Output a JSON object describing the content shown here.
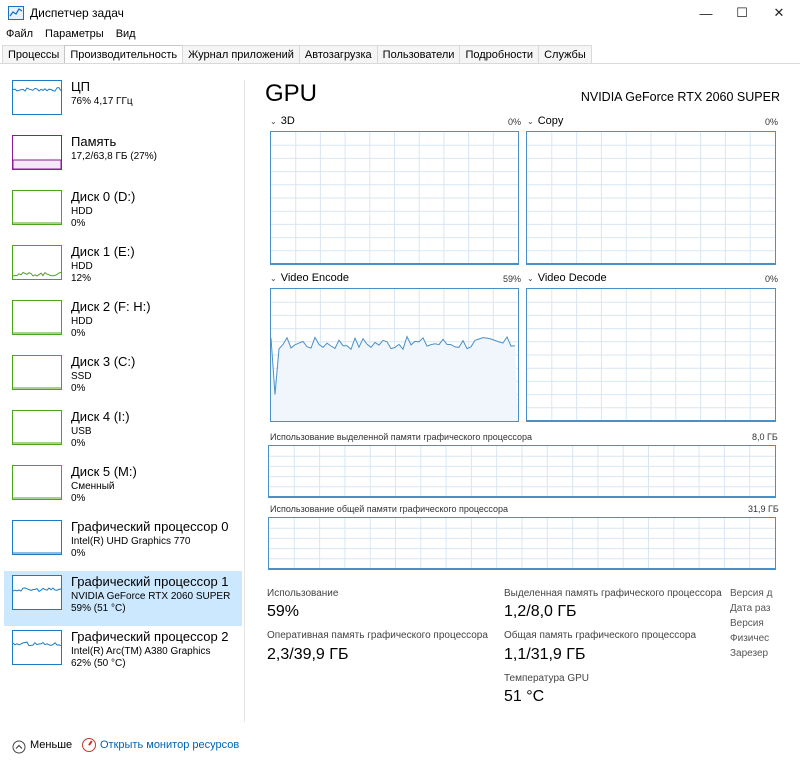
{
  "window": {
    "title": "Диспетчер задач",
    "minimize": "—",
    "maximize": "☐",
    "close": "✕"
  },
  "menu": [
    "Файл",
    "Параметры",
    "Вид"
  ],
  "tabs": [
    "Процессы",
    "Производительность",
    "Журнал приложений",
    "Автозагрузка",
    "Пользователи",
    "Подробности",
    "Службы"
  ],
  "active_tab": "Производительность",
  "sidebar": {
    "items": [
      {
        "name": "ЦП",
        "sub1": "76% 4,17 ГГц",
        "sub2": "",
        "color": "#1c7bc4",
        "usage": 0.76
      },
      {
        "name": "Память",
        "sub1": "17,2/63,8 ГБ (27%)",
        "sub2": "",
        "color": "#8a1b99",
        "usage": 0.27
      },
      {
        "name": "Диск 0 (D:)",
        "sub1": "HDD",
        "sub2": "0%",
        "color": "#4ca61c",
        "usage": 0
      },
      {
        "name": "Диск 1 (E:)",
        "sub1": "HDD",
        "sub2": "12%",
        "color": "#4ca61c",
        "usage": 0.12
      },
      {
        "name": "Диск 2 (F: H:)",
        "sub1": "HDD",
        "sub2": "0%",
        "color": "#4ca61c",
        "usage": 0
      },
      {
        "name": "Диск 3 (C:)",
        "sub1": "SSD",
        "sub2": "0%",
        "color": "#4ca61c",
        "usage": 0
      },
      {
        "name": "Диск 4 (I:)",
        "sub1": "USB",
        "sub2": "0%",
        "color": "#4ca61c",
        "usage": 0
      },
      {
        "name": "Диск 5 (M:)",
        "sub1": "Сменный",
        "sub2": "0%",
        "color": "#4ca61c",
        "usage": 0
      },
      {
        "name": "Графический процессор 0",
        "sub1": "Intel(R) UHD Graphics 770",
        "sub2": "0%",
        "color": "#1c7bc4",
        "usage": 0
      },
      {
        "name": "Графический процессор 1",
        "sub1": "NVIDIA GeForce RTX 2060 SUPER",
        "sub2": "59% (51 °C)",
        "color": "#1c7bc4",
        "usage": 0.59
      },
      {
        "name": "Графический процессор 2",
        "sub1": "Intel(R) Arc(TM) A380 Graphics",
        "sub2": "62% (50 °C)",
        "color": "#1c7bc4",
        "usage": 0.62
      }
    ],
    "selected_index": 9
  },
  "main": {
    "title": "GPU",
    "gpu_name": "NVIDIA GeForce RTX 2060 SUPER",
    "engines": [
      {
        "label": "3D",
        "pct": "0%",
        "usage": 0
      },
      {
        "label": "Copy",
        "pct": "0%",
        "usage": 0
      },
      {
        "label": "Video Encode",
        "pct": "59%",
        "usage": 0.59
      },
      {
        "label": "Video Decode",
        "pct": "0%",
        "usage": 0
      }
    ],
    "dedicated_mem": {
      "label": "Использование выделенной памяти графического процессора",
      "max": "8,0 ГБ"
    },
    "shared_mem": {
      "label": "Использование общей памяти графического процессора",
      "max": "31,9 ГБ"
    },
    "stats": {
      "usage_label": "Использование",
      "usage_value": "59%",
      "dedicated_label": "Выделенная память графического процессора",
      "dedicated_value": "1,2/8,0 ГБ",
      "gpu_ram_label": "Оперативная память графического процессора",
      "gpu_ram_value": "2,3/39,9 ГБ",
      "shared_label": "Общая память графического процессора",
      "shared_value": "1,1/31,9 ГБ",
      "temp_label": "Температура GPU",
      "temp_value": "51 °C"
    },
    "info_labels": [
      "Версия д",
      "Дата раз",
      "Версия ",
      "Физичес",
      "Зарезер"
    ]
  },
  "bottom": {
    "fewer_label": "Меньше",
    "monitor_label": "Открыть монитор ресурсов"
  }
}
